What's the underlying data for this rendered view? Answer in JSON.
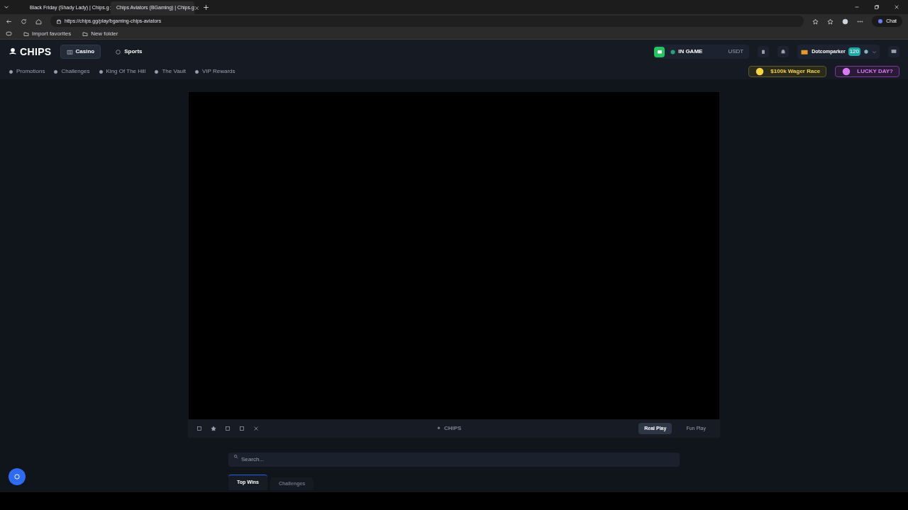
{
  "browser": {
    "tabs": [
      {
        "title": "Black Friday (Shady Lady) | Chips.g",
        "selected": false
      },
      {
        "title": "Chips Aviators (BGaming) | Chips.g",
        "selected": true
      }
    ],
    "url": "https://chips.gg/play/bgaming-chips-aviators",
    "chat_button": "Chat",
    "bookmarks": [
      "Import favorites",
      "New folder"
    ]
  },
  "header": {
    "logo": "CHIPS",
    "nav": [
      {
        "label": "Casino",
        "selected": true
      },
      {
        "label": "Sports",
        "selected": false
      }
    ],
    "wallet": {
      "status": "IN GAME",
      "currency": "USDT"
    },
    "user": {
      "name": "Dotcomparker",
      "level": "120"
    }
  },
  "subnav": [
    "Promotions",
    "Challenges",
    "King Of The Hill",
    "The Vault",
    "VIP Rewards"
  ],
  "promos": [
    "$100k Wager Race",
    "LUCKY DAY?"
  ],
  "game": {
    "brand": "CHIPS",
    "modes": [
      {
        "label": "Real Play",
        "selected": true
      },
      {
        "label": "Fun Play",
        "selected": false
      }
    ]
  },
  "search": {
    "placeholder": "Search..."
  },
  "tabs": [
    {
      "label": "Top Wins",
      "selected": true
    },
    {
      "label": "Challenges",
      "selected": false
    }
  ]
}
